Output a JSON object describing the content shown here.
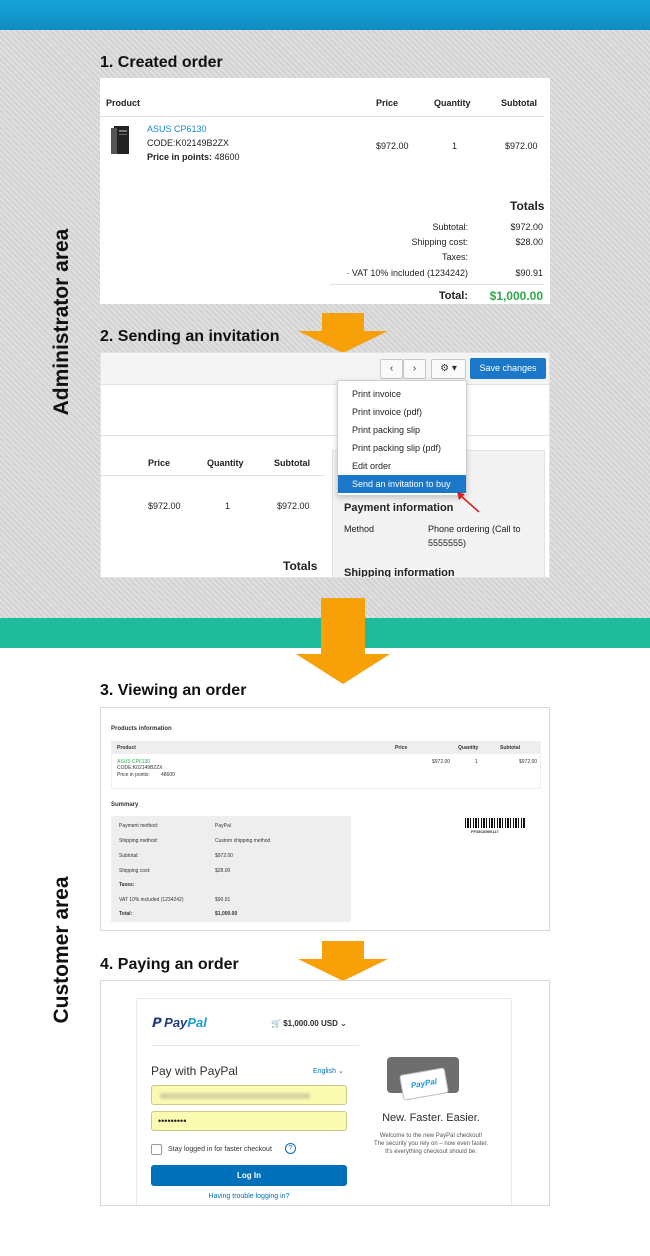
{
  "areas": {
    "admin": "Administrator area",
    "customer": "Customer area"
  },
  "steps": {
    "s1": "1. Created order",
    "s2": "2. Sending an invitation",
    "s3": "3. Viewing an order",
    "s4": "4. Paying an order"
  },
  "colors": {
    "top_bar": "#17a3d8",
    "teal_bar": "#1fbc9c",
    "arrow": "#f7a008",
    "accent_blue": "#1b78c9",
    "total_green": "#2ea84b"
  },
  "order": {
    "headers": {
      "product": "Product",
      "price": "Price",
      "quantity": "Quantity",
      "subtotal": "Subtotal"
    },
    "item": {
      "name": "ASUS CP6130",
      "code": "CODE:K02149B2ZX",
      "points_label": "Price in points:",
      "points_value": "48600",
      "price": "$972.00",
      "quantity": "1",
      "subtotal": "$972.00"
    },
    "totals": {
      "heading": "Totals",
      "subtotal_label": "Subtotal:",
      "subtotal_value": "$972.00",
      "shipping_label": "Shipping cost:",
      "shipping_value": "$28.00",
      "taxes_label": "Taxes:",
      "vat_label": "· VAT 10% included (1234242)",
      "vat_value": "$90.91",
      "total_label": "Total:",
      "total_value": "$1,000.00"
    }
  },
  "invite": {
    "save_button": "Save changes",
    "menu": [
      "Print invoice",
      "Print invoice (pdf)",
      "Print packing slip",
      "Print packing slip (pdf)",
      "Edit order",
      "Send an invitation to buy"
    ],
    "headers": {
      "price": "Price",
      "quantity": "Quantity",
      "subtotal": "Subtotal"
    },
    "row": {
      "price": "$972.00",
      "quantity": "1",
      "subtotal": "$972.00"
    },
    "totals_heading": "Totals",
    "payment_heading": "Payment information",
    "method_label": "Method",
    "method_value_1": "Phone ordering (Call to",
    "method_value_2": "5555555)",
    "shipping_heading": "Shipping information"
  },
  "customer_view": {
    "products_heading": "Products information",
    "headers": {
      "product": "Product",
      "price": "Price",
      "quantity": "Quantity",
      "subtotal": "Subtotal"
    },
    "item": {
      "name": "ASUS CP6130",
      "code": "CODE:K02149B2ZX",
      "points_label": "Price in points:",
      "points_value": "48600",
      "price": "$972.00",
      "quantity": "1",
      "subtotal": "$972.00"
    },
    "summary_heading": "Summary",
    "summary_rows": [
      {
        "label": "Payment method:",
        "value": "PayPal"
      },
      {
        "label": "Shipping method:",
        "value": "Custom shipping method"
      },
      {
        "label": "Subtotal:",
        "value": "$972.00"
      },
      {
        "label": "Shipping cost:",
        "value": "$28.00"
      },
      {
        "label": "Taxes:",
        "value": ""
      },
      {
        "label": "VAT 10% included (1234242)",
        "value": "$90.91"
      },
      {
        "label": "Total:",
        "value": "$1,000.00"
      }
    ],
    "barcode_text": "FF45C8990117"
  },
  "paypal": {
    "logo_pay": "Pay",
    "logo_pal": "Pal",
    "cart_amount": "$1,000.00 USD",
    "title": "Pay with PayPal",
    "language": "English",
    "password_mask": "•••••••••",
    "stay_logged": "Stay logged in for faster checkout",
    "help_mark": "?",
    "login_button": "Log In",
    "trouble_link": "Having trouble logging in?",
    "card_text": "PayPal",
    "right_title": "New. Faster. Easier.",
    "right_line_1": "Welcome to the new PayPal checkout!",
    "right_line_2": "The security you rely on – now even faster.",
    "right_line_3": "It's everything checkout should be."
  }
}
